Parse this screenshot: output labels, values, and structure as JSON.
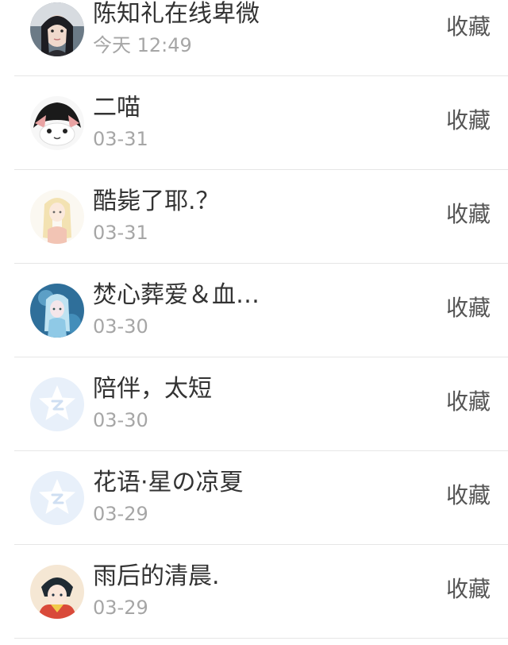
{
  "list": {
    "items": [
      {
        "name": "陈知礼在线卑微",
        "date": "今天 12:49",
        "action": "收藏",
        "avatar": "photo-avatar"
      },
      {
        "name": "二喵",
        "date": "03-31",
        "action": "收藏",
        "avatar": "cat-avatar"
      },
      {
        "name": "酷毙了耶.？",
        "date": "03-31",
        "action": "收藏",
        "avatar": "anime-girl-avatar"
      },
      {
        "name": "焚心葬爱＆血…",
        "date": "03-30",
        "action": "收藏",
        "avatar": "anime-blue-avatar"
      },
      {
        "name": "陪伴，太短",
        "date": "03-30",
        "action": "收藏",
        "avatar": "qzone-default-avatar"
      },
      {
        "name": "花语·星の凉夏",
        "date": "03-29",
        "action": "收藏",
        "avatar": "qzone-default-avatar"
      },
      {
        "name": "雨后的清晨.",
        "date": "03-29",
        "action": "收藏",
        "avatar": "anime-boy-avatar"
      }
    ]
  }
}
